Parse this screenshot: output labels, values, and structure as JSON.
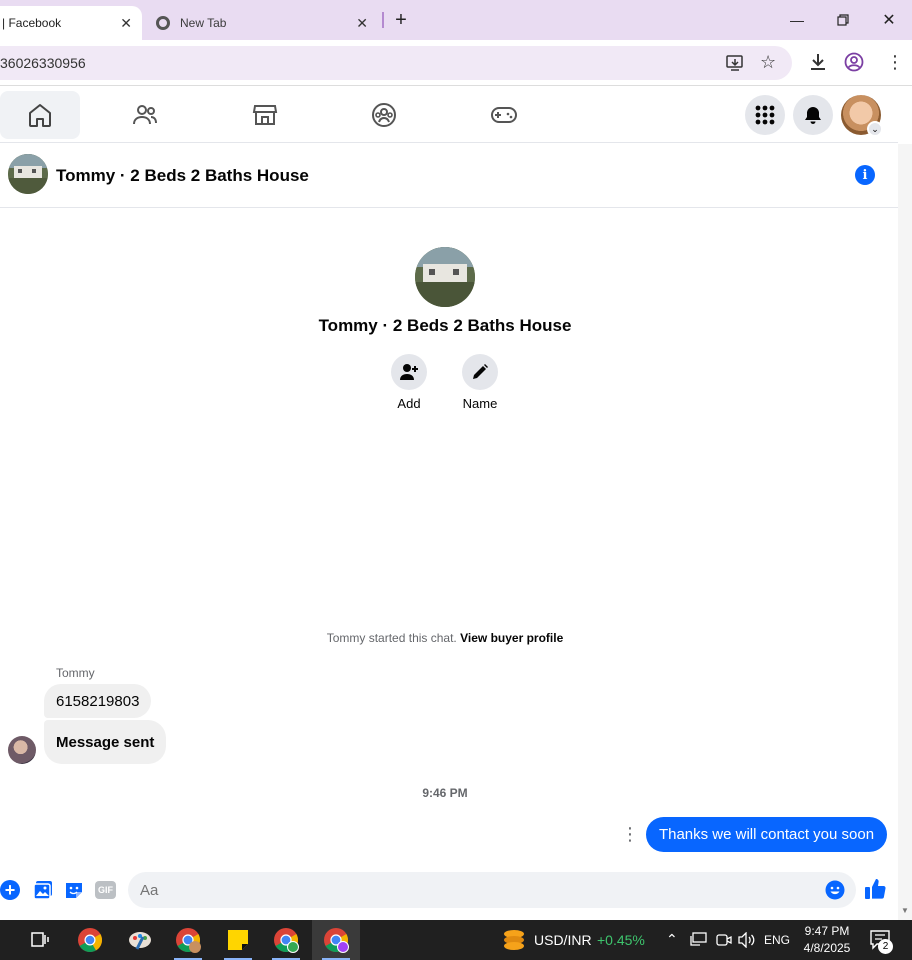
{
  "browser": {
    "tabs": [
      {
        "title": "| Facebook",
        "active": true
      },
      {
        "title": "New Tab",
        "active": false
      }
    ],
    "url": "36026330956"
  },
  "chat": {
    "header_title": "Tommy · 2 Beds 2 Baths House",
    "profile_name": "Tommy · 2 Beds 2 Baths House",
    "actions": [
      {
        "label": "Add",
        "icon": "add-person-icon"
      },
      {
        "label": "Name",
        "icon": "pencil-icon"
      }
    ],
    "started_notice": "Tommy started this chat.",
    "view_profile_link": "View buyer profile",
    "sender_name": "Tommy",
    "messages_in": [
      "6158219803",
      "Message sent"
    ],
    "timestamp": "9:46 PM",
    "message_out": "Thanks we will contact you soon",
    "composer_placeholder": "Aa"
  },
  "taskbar": {
    "ticker_label": "USD/INR",
    "ticker_change": "+0.45%",
    "language": "ENG",
    "time": "9:47 PM",
    "date": "4/8/2025",
    "notification_count": "2"
  },
  "colors": {
    "accent": "#0866ff",
    "tabbar": "#e9dcf2",
    "ticker_up": "#3ec46d"
  }
}
